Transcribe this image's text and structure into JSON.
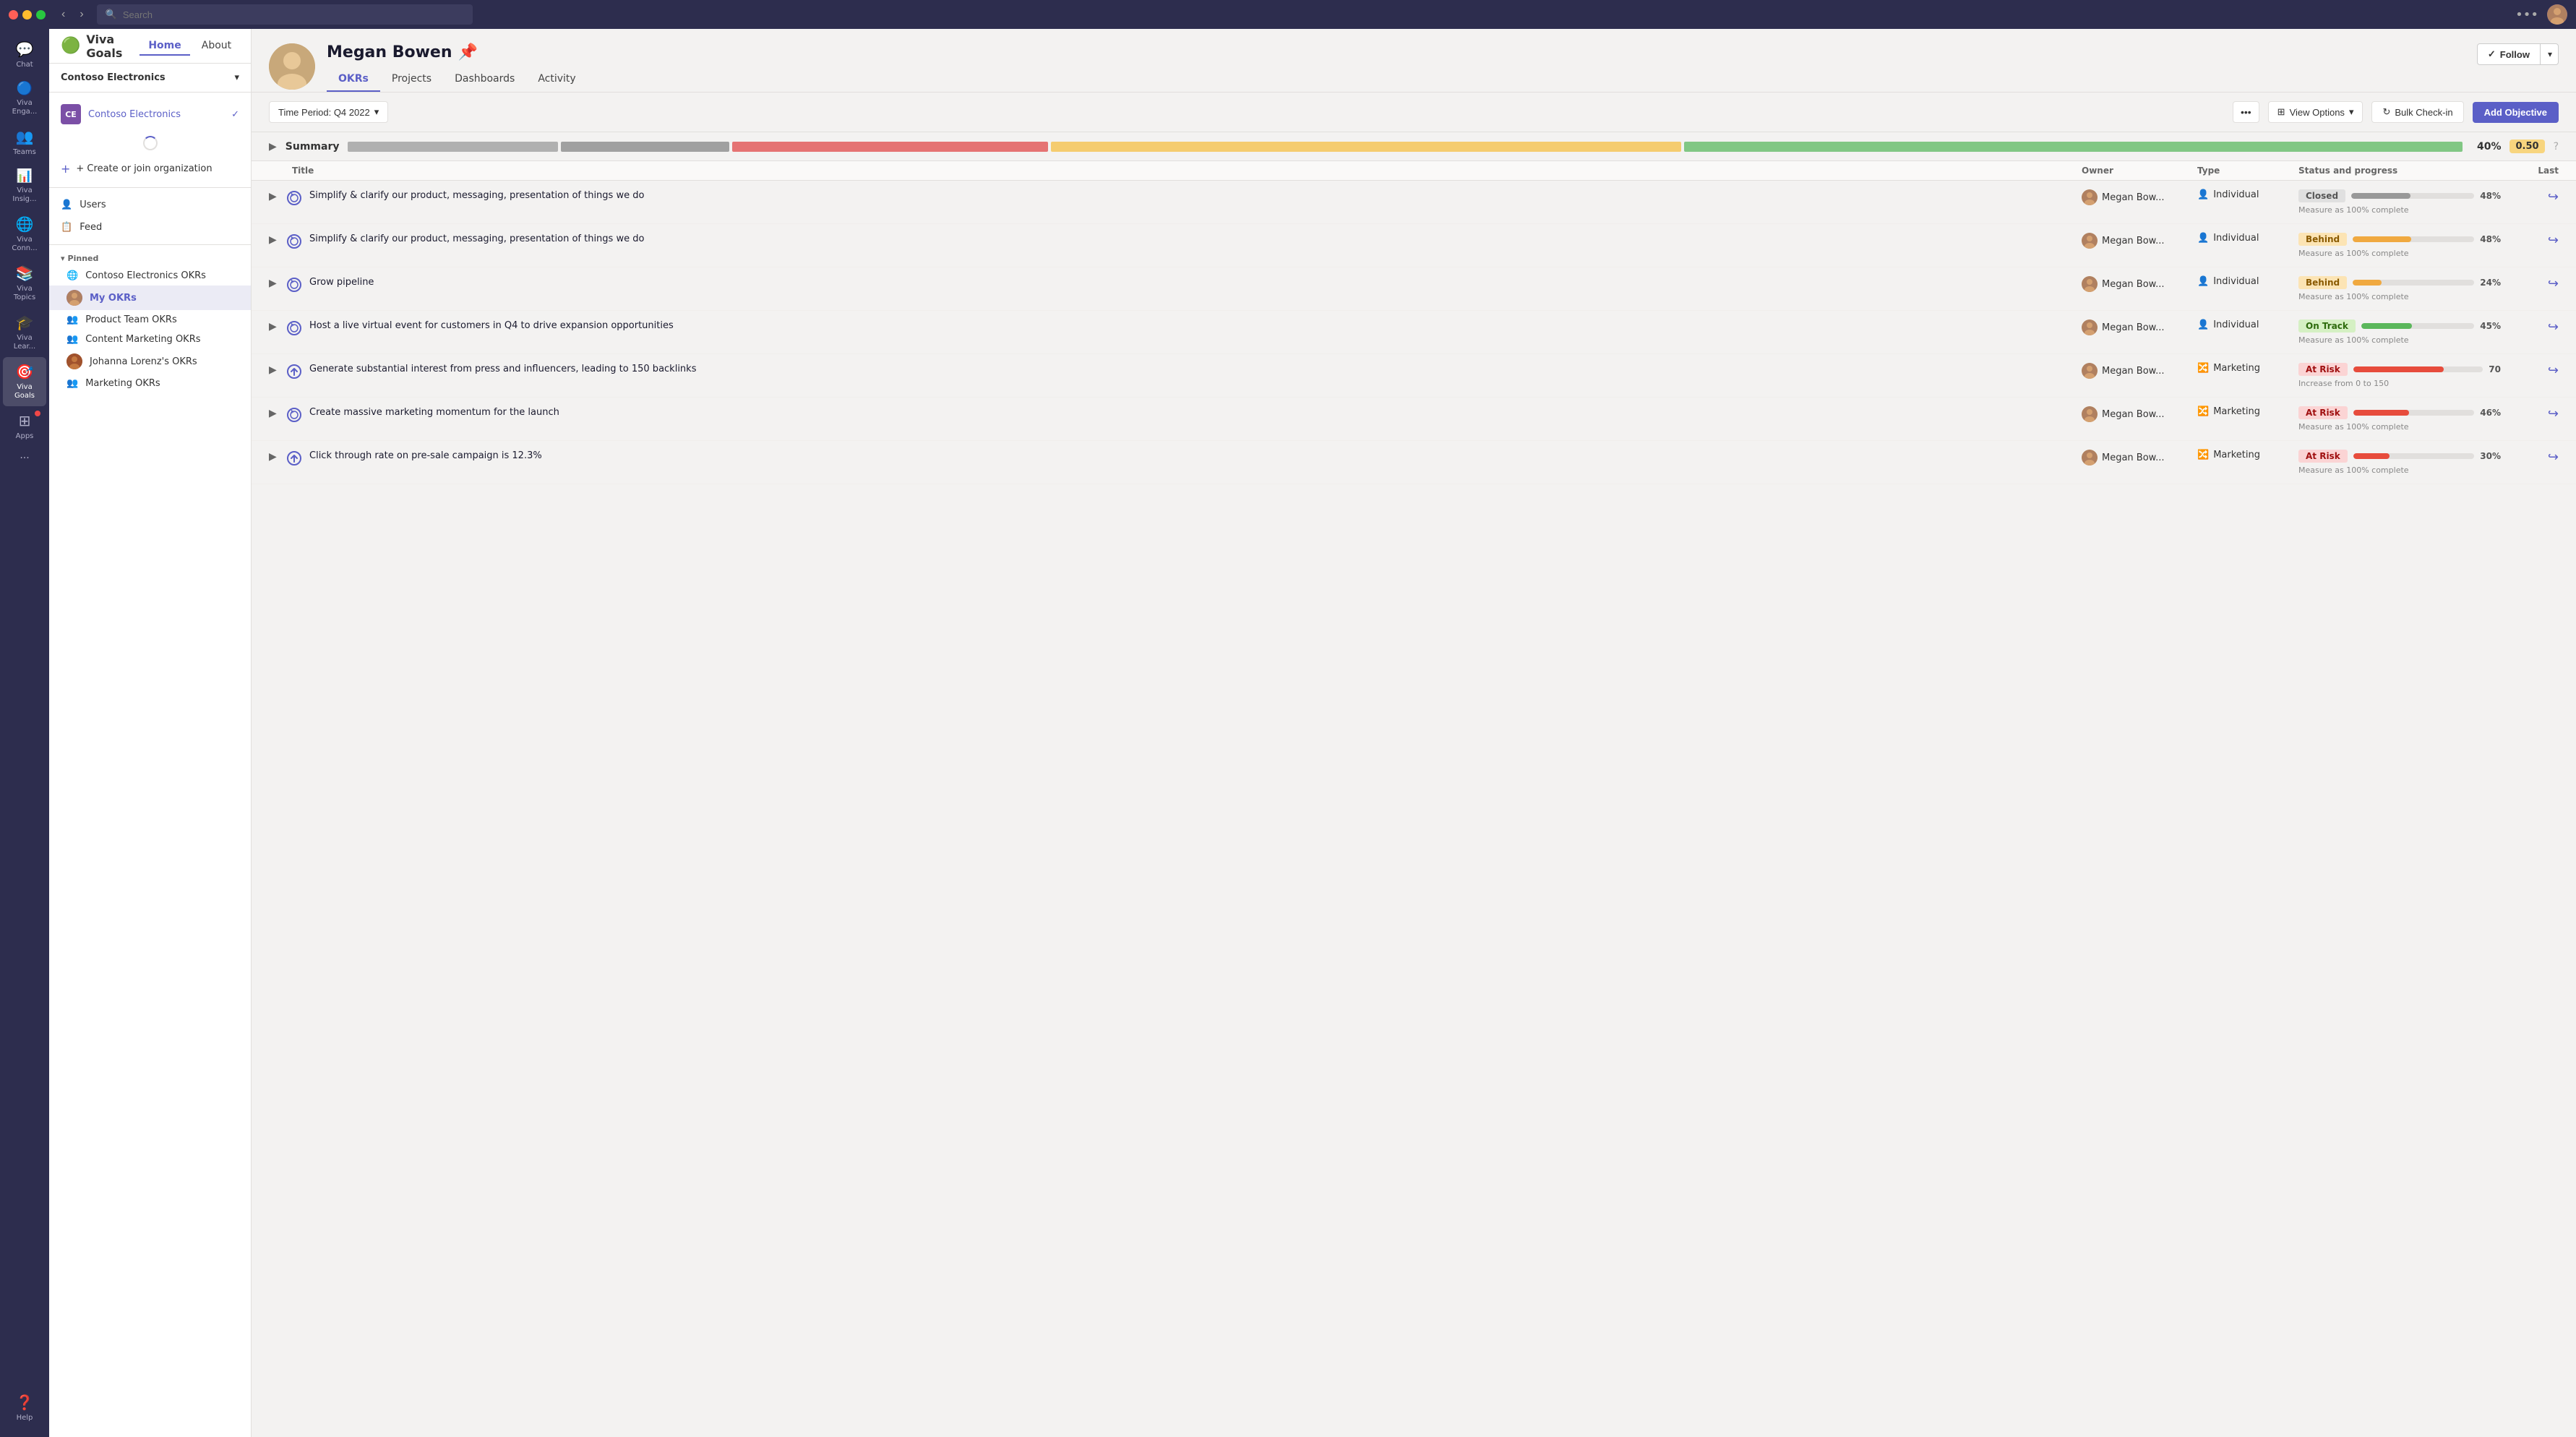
{
  "titleBar": {
    "searchPlaceholder": "Search",
    "navBack": "‹",
    "navForward": "›",
    "dotsLabel": "•••"
  },
  "iconSidebar": {
    "items": [
      {
        "id": "chat",
        "label": "Chat",
        "icon": "💬",
        "active": false,
        "hasNotif": false
      },
      {
        "id": "viva-engage",
        "label": "Viva Enga...",
        "icon": "🔵",
        "active": false,
        "hasNotif": false
      },
      {
        "id": "teams",
        "label": "Teams",
        "icon": "👥",
        "active": false,
        "hasNotif": false
      },
      {
        "id": "viva-insights",
        "label": "Viva Insig...",
        "icon": "📊",
        "active": false,
        "hasNotif": false
      },
      {
        "id": "viva-connections",
        "label": "Viva Conn...",
        "icon": "🌐",
        "active": false,
        "hasNotif": false
      },
      {
        "id": "viva-topics",
        "label": "Viva Topics",
        "icon": "📚",
        "active": false,
        "hasNotif": false
      },
      {
        "id": "viva-learning",
        "label": "Viva Lear...",
        "icon": "🎓",
        "active": false,
        "hasNotif": false
      },
      {
        "id": "viva-goals",
        "label": "Viva Goals",
        "icon": "🎯",
        "active": true,
        "hasNotif": false
      },
      {
        "id": "apps",
        "label": "Apps",
        "icon": "⊞",
        "active": false,
        "hasNotif": true
      },
      {
        "id": "more",
        "label": "···",
        "icon": "···",
        "active": false,
        "hasNotif": false
      }
    ],
    "bottomItems": [
      {
        "id": "help",
        "label": "Help",
        "icon": "❓"
      }
    ]
  },
  "leftPanel": {
    "orgSelector": {
      "label": "Contoso Electronics",
      "chevron": "▾"
    },
    "orgDropdown": {
      "items": [
        {
          "id": "contoso-electronics",
          "badge": "CE",
          "label": "Contoso Electronics",
          "selected": true
        }
      ],
      "loading": true,
      "createJoin": "+ Create or join organization"
    },
    "navItems": [
      {
        "id": "users",
        "icon": "👤",
        "label": "Users"
      },
      {
        "id": "feed",
        "icon": "📋",
        "label": "Feed"
      }
    ],
    "pinnedSection": {
      "label": "▾ Pinned",
      "items": [
        {
          "id": "contoso-okrs",
          "icon": "🌐",
          "label": "Contoso Electronics OKRs",
          "hasAvatar": false
        },
        {
          "id": "my-okrs",
          "label": "My OKRs",
          "hasAvatar": true,
          "active": true
        },
        {
          "id": "product-team-okrs",
          "icon": "👥",
          "label": "Product Team OKRs",
          "hasAvatar": false
        },
        {
          "id": "content-marketing-okrs",
          "icon": "👥",
          "label": "Content Marketing OKRs",
          "hasAvatar": false
        },
        {
          "id": "johanna-lorenz-okrs",
          "label": "Johanna Lorenz's OKRs",
          "hasAvatar": true
        },
        {
          "id": "marketing-okrs",
          "icon": "👥",
          "label": "Marketing OKRs",
          "hasAvatar": false
        }
      ]
    }
  },
  "header": {
    "appLogo": "🟢",
    "appName": "Viva Goals",
    "navItems": [
      {
        "id": "home",
        "label": "Home",
        "active": true
      },
      {
        "id": "about",
        "label": "About",
        "active": false
      }
    ],
    "icons": {
      "refresh": "↻",
      "help": "?",
      "bell": "🔔",
      "more": "···"
    }
  },
  "profile": {
    "name": "Megan Bowen",
    "pinIcon": "📌",
    "tabs": [
      {
        "id": "okrs",
        "label": "OKRs",
        "active": true
      },
      {
        "id": "projects",
        "label": "Projects",
        "active": false
      },
      {
        "id": "dashboards",
        "label": "Dashboards",
        "active": false
      },
      {
        "id": "activity",
        "label": "Activity",
        "active": false
      }
    ],
    "followBtn": {
      "checkIcon": "✓",
      "label": "Follow",
      "arrowLabel": "▾"
    }
  },
  "toolbar": {
    "timePeriodLabel": "Time Period: Q4 2022",
    "timePeriodChevron": "▾",
    "dotsLabel": "•••",
    "viewOptionsIcon": "⊞",
    "viewOptionsLabel": "View Options",
    "viewOptionsChevron": "▾",
    "bulkCheckinIcon": "↻",
    "bulkCheckinLabel": "Bulk Check-in",
    "addObjectiveLabel": "Add Objective"
  },
  "summary": {
    "label": "Summary",
    "bars": [
      {
        "color": "#c0bec0",
        "width": 10
      },
      {
        "color": "#b8b8b8",
        "width": 8
      },
      {
        "color": "#e57373",
        "width": 15
      },
      {
        "color": "#f5cc6f",
        "width": 30
      },
      {
        "color": "#81c784",
        "width": 37
      }
    ],
    "percent": "40%",
    "score": "0.50"
  },
  "tableHeader": {
    "title": "Title",
    "owner": "Owner",
    "type": "Type",
    "statusProgress": "Status and progress",
    "last": "Last"
  },
  "okrRows": [
    {
      "id": 1,
      "title": "Simplify & clarify our product, messaging, presentation of things we do",
      "owner": "Megan Bow...",
      "type": "Individual",
      "status": "Closed",
      "statusClass": "status-closed",
      "progressColor": "#999",
      "progressPct": 48,
      "pctLabel": "48%",
      "measure": "Measure as 100% complete",
      "iconType": "target"
    },
    {
      "id": 2,
      "title": "Simplify & clarify our product, messaging, presentation of things we do",
      "owner": "Megan Bow...",
      "type": "Individual",
      "status": "Behind",
      "statusClass": "status-behind",
      "progressColor": "#f0a940",
      "progressPct": 48,
      "pctLabel": "48%",
      "measure": "Measure as 100% complete",
      "iconType": "target"
    },
    {
      "id": 3,
      "title": "Grow pipeline",
      "owner": "Megan Bow...",
      "type": "Individual",
      "status": "Behind",
      "statusClass": "status-behind",
      "progressColor": "#f0a940",
      "progressPct": 24,
      "pctLabel": "24%",
      "measure": "Measure as 100% complete",
      "iconType": "target"
    },
    {
      "id": 4,
      "title": "Host a live virtual event for customers in Q4 to drive expansion opportunities",
      "owner": "Megan Bow...",
      "type": "Individual",
      "status": "On Track",
      "statusClass": "status-on-track",
      "progressColor": "#5bb75b",
      "progressPct": 45,
      "pctLabel": "45%",
      "measure": "Measure as 100% complete",
      "iconType": "target"
    },
    {
      "id": 5,
      "title": "Generate substantial interest from press and influencers, leading to 150 backlinks",
      "owner": "Megan Bow...",
      "type": "Marketing",
      "status": "At Risk",
      "statusClass": "status-at-risk",
      "progressColor": "#e74c3c",
      "progressPct": 70,
      "pctLabel": "70",
      "measure": "Increase from 0 to 150",
      "iconType": "arrow"
    },
    {
      "id": 6,
      "title": "Create massive marketing momentum for the launch",
      "owner": "Megan Bow...",
      "type": "Marketing",
      "status": "At Risk",
      "statusClass": "status-at-risk",
      "progressColor": "#e74c3c",
      "progressPct": 46,
      "pctLabel": "46%",
      "measure": "Measure as 100% complete",
      "iconType": "target"
    },
    {
      "id": 7,
      "title": "Click through rate on pre-sale campaign is 12.3%",
      "owner": "Megan Bow...",
      "type": "Marketing",
      "status": "At Risk",
      "statusClass": "status-at-risk",
      "progressColor": "#e74c3c",
      "progressPct": 30,
      "pctLabel": "30%",
      "measure": "Measure as 100% complete",
      "iconType": "arrow"
    }
  ]
}
